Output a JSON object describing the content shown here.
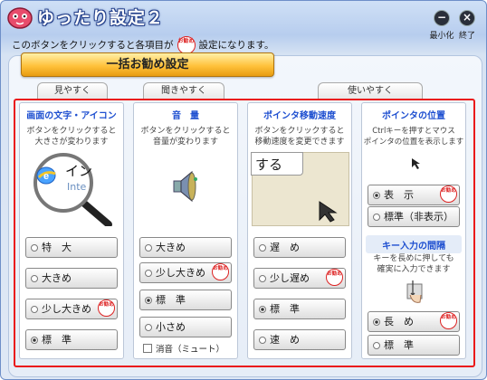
{
  "app": {
    "title": "ゆったり設定２"
  },
  "window_controls": {
    "minimize_label": "最小化",
    "close_label": "終了"
  },
  "info": {
    "text_before": "このボタンをクリックすると各項目が",
    "text_after": "設定になります。",
    "stamp_text": "お勧め"
  },
  "bulk_button": {
    "label": "一括お勧め設定"
  },
  "categories": [
    "見やすく",
    "聞きやすく",
    "使いやすく"
  ],
  "columns": [
    {
      "title": "画面の文字・アイコン",
      "desc": [
        "ボタンをクリックすると",
        "大きさが変わります"
      ],
      "preview": {
        "text_big": "イン",
        "text_small": "Inte"
      },
      "options": [
        {
          "label": "特　大",
          "selected": false,
          "recommended": false
        },
        {
          "label": "大きめ",
          "selected": false,
          "recommended": false
        },
        {
          "label": "少し大きめ",
          "selected": false,
          "recommended": true
        },
        {
          "label": "標　準",
          "selected": true,
          "recommended": false
        }
      ]
    },
    {
      "title": "音　量",
      "desc": [
        "ボタンをクリックすると",
        "音量が変わります"
      ],
      "options": [
        {
          "label": "大きめ",
          "selected": false,
          "recommended": false
        },
        {
          "label": "少し大きめ",
          "selected": false,
          "recommended": true
        },
        {
          "label": "標　準",
          "selected": true,
          "recommended": false
        },
        {
          "label": "小さめ",
          "selected": false,
          "recommended": false
        }
      ],
      "mute_label": "消音（ミュート）"
    },
    {
      "title": "ポインタ移動速度",
      "desc": [
        "ボタンをクリックすると",
        "移動速度を変更できます"
      ],
      "preview": {
        "text": "する"
      },
      "options": [
        {
          "label": "遅　め",
          "selected": false,
          "recommended": false
        },
        {
          "label": "少し遅め",
          "selected": false,
          "recommended": true
        },
        {
          "label": "標　準",
          "selected": true,
          "recommended": false
        },
        {
          "label": "速　め",
          "selected": false,
          "recommended": false
        }
      ]
    },
    {
      "title": "ポインタの位置",
      "desc": [
        "Ctrlキーを押すとマウス",
        "ポインタの位置を表示します"
      ],
      "options": [
        {
          "label": "表　示",
          "selected": true,
          "recommended": true
        },
        {
          "label": "標準（非表示）",
          "selected": false,
          "recommended": false
        }
      ],
      "sub": {
        "title": "キー入力の間隔",
        "desc": [
          "キーを長めに押しても",
          "確実に入力できます"
        ],
        "options": [
          {
            "label": "長　め",
            "selected": true,
            "recommended": true
          },
          {
            "label": "標　準",
            "selected": false,
            "recommended": false
          }
        ]
      }
    }
  ],
  "colors": {
    "accent_blue": "#1e4fd0",
    "frame_red": "#ea1a1a",
    "button_orange": "#ffc23c",
    "stamp_red": "#dd2222"
  }
}
